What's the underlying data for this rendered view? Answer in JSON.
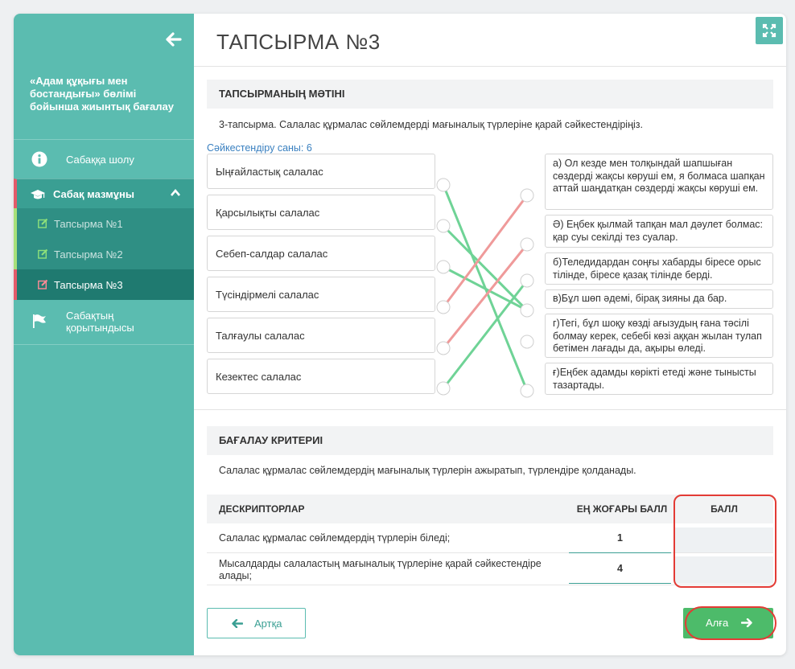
{
  "sidebar": {
    "course_title": "«Адам құқығы мен бостандығы» бөлімі бойынша жиынтық бағалау",
    "nav": {
      "overview": "Сабаққа шолу",
      "content": "Сабақ мазмұны",
      "tasks": [
        "Тапсырма №1",
        "Тапсырма №2",
        "Тапсырма №3"
      ],
      "summary": "Сабақтың қорытындысы"
    }
  },
  "main": {
    "title": "ТАПСЫРМА №3",
    "task_section": {
      "heading": "ТАПСЫРМАНЫҢ МӘТІНІ",
      "text": "3-тапсырма. Салалас құрмалас сөйлемдерді мағыналық түрлеріне қарай сәйкестендіріңіз.",
      "match_count": "Сәйкестендіру саны: 6",
      "left_items": [
        "Ыңғайластық салалас",
        "Қарсылықты салалас",
        "Себеп-салдар салалас",
        "Түсіндірмелі салалас",
        "Талғаулы салалас",
        "Кезектес салалас"
      ],
      "right_items": [
        "а) Ол кезде мен толқындай шапшыған сөздерді жақсы көруші ем, я болмаса шапқан аттай шаңдатқан сөздерді жақсы көруші ем.",
        "Ә) Еңбек қылмай тапқан мал дәулет болмас: қар суы секілді тез суалар.",
        "б)Теледидардан соңғы хабарды біресе орыс тілінде, біресе қазақ тілінде берді.",
        "в)Бұл шөп әдемі, бірақ зияны да бар.",
        "г)Тегі, бұл шоқу көзді ағызудың ғана тәсілі болмау керек, себебі көзі аққан жылан тулап бетімен лағады да, ақыры өледі.",
        "ғ)Еңбек адамды көрікті етеді және тынысты тазартады."
      ],
      "connections": [
        {
          "from": 0,
          "to": 5,
          "color": "#6fd396"
        },
        {
          "from": 1,
          "to": 3,
          "color": "#6fd396"
        },
        {
          "from": 2,
          "to": 3,
          "color": "#6fd396"
        },
        {
          "from": 3,
          "to": 0,
          "color": "#ef9a9a"
        },
        {
          "from": 4,
          "to": 1,
          "color": "#ef9a9a"
        },
        {
          "from": 5,
          "to": 2,
          "color": "#6fd396"
        }
      ]
    },
    "criteria_section": {
      "heading": "БАҒАЛАУ КРИТЕРИІ",
      "text": " Салалас құрмалас сөйлемдердің мағыналық түрлерін ажыратып, түрлендіре қолданады.",
      "columns": {
        "descriptors": "ДЕСКРИПТОРЛАР",
        "max": "ЕҢ ЖОҒАРЫ БАЛЛ",
        "score": "БАЛЛ"
      },
      "rows": [
        {
          "text": "Салалас құрмалас сөйлемдердің түрлерін біледі;",
          "max": "1",
          "score": ""
        },
        {
          "text": "Мысалдарды салаластың мағыналық түрлеріне қарай сәйкестендіре алады;",
          "max": "4",
          "score": ""
        }
      ]
    },
    "buttons": {
      "back": "Артқа",
      "next": "Алға"
    }
  },
  "colors": {
    "sidebar": "#5bbcb0",
    "accent_red": "#e33b35",
    "next_button": "#4dbb6a",
    "line_correct": "#6fd396",
    "line_wrong": "#ef9a9a"
  },
  "icons": [
    "back-arrow-icon",
    "info-icon",
    "graduation-cap-icon",
    "chevron-up-icon",
    "edit-icon",
    "flag-icon",
    "expand-icon",
    "arrow-left-icon",
    "arrow-right-icon"
  ]
}
